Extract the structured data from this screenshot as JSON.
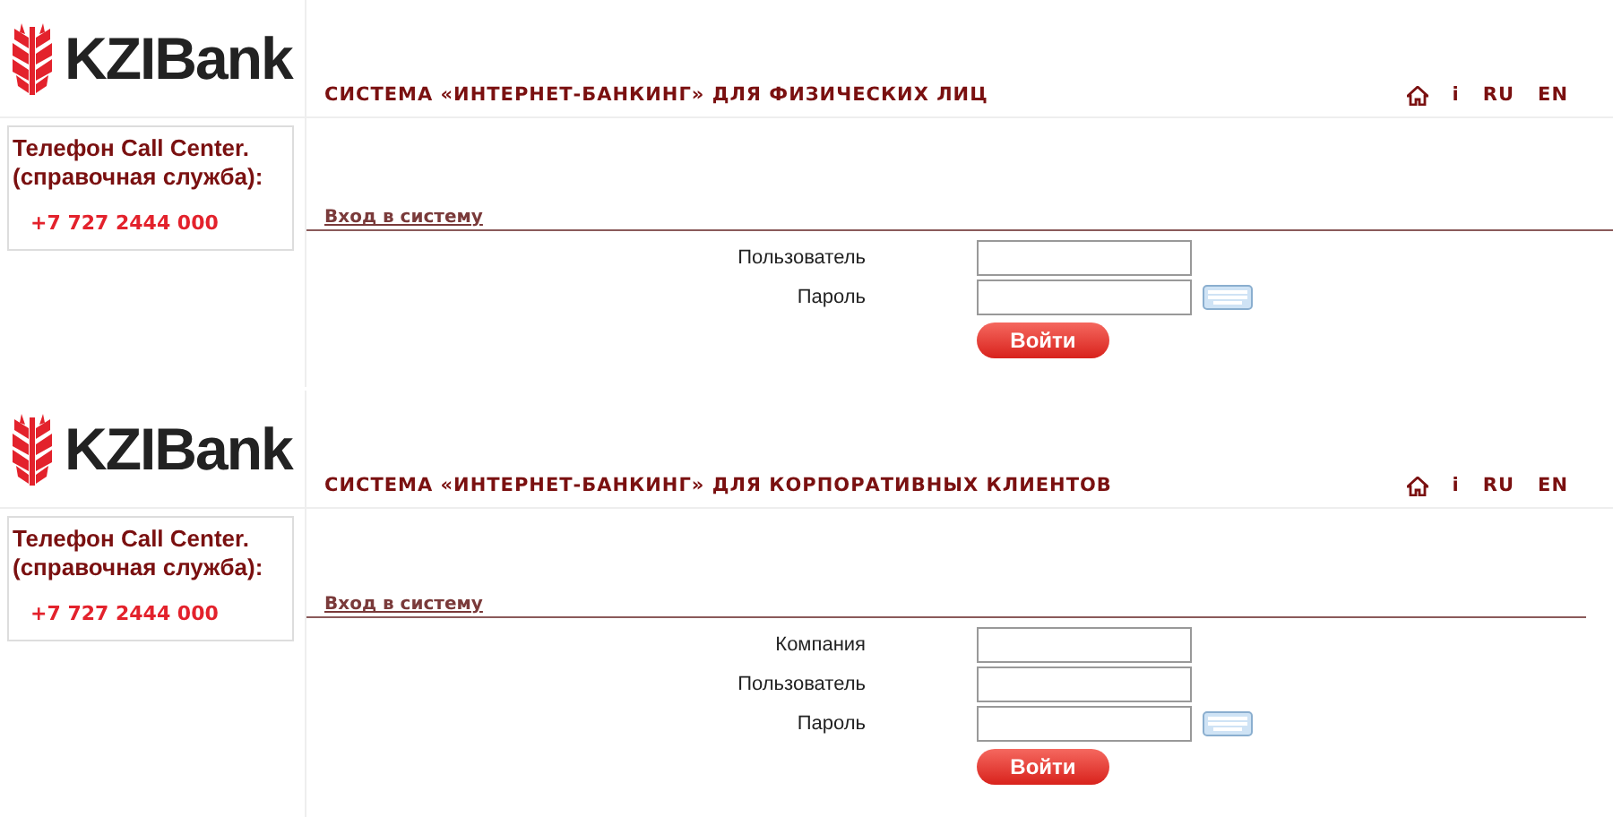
{
  "panels": [
    {
      "logo": "KZIBank",
      "title": "СИСТЕМА «ИНТЕРНЕТ-БАНКИНГ» ДЛЯ ФИЗИЧЕСКИХ ЛИЦ",
      "nav": [
        {
          "kind": "home"
        },
        {
          "kind": "text",
          "label": "i"
        },
        {
          "kind": "text",
          "label": "RU"
        },
        {
          "kind": "text",
          "label": "EN"
        }
      ],
      "contact_title": "Телефон Call Center. (справочная служба):",
      "phone": "+7 727 2444 000",
      "login_heading": "Вход в систему",
      "fields": [
        {
          "label": "Пользователь",
          "keyboard": false
        },
        {
          "label": "Пароль",
          "keyboard": true
        }
      ],
      "button": "Войти"
    },
    {
      "logo": "KZIBank",
      "title": "СИСТЕМА «ИНТЕРНЕТ-БАНКИНГ» ДЛЯ КОРПОРАТИВНЫХ КЛИЕНТОВ",
      "nav": [
        {
          "kind": "home"
        },
        {
          "kind": "text",
          "label": "i"
        },
        {
          "kind": "text",
          "label": "RU"
        },
        {
          "kind": "text",
          "label": "EN"
        }
      ],
      "contact_title": "Телефон Call Center. (справочная служба):",
      "phone": "+7 727 2444 000",
      "login_heading": "Вход в систему",
      "fields": [
        {
          "label": "Компания",
          "keyboard": false
        },
        {
          "label": "Пользователь",
          "keyboard": false
        },
        {
          "label": "Пароль",
          "keyboard": true
        }
      ],
      "button": "Войти"
    }
  ]
}
